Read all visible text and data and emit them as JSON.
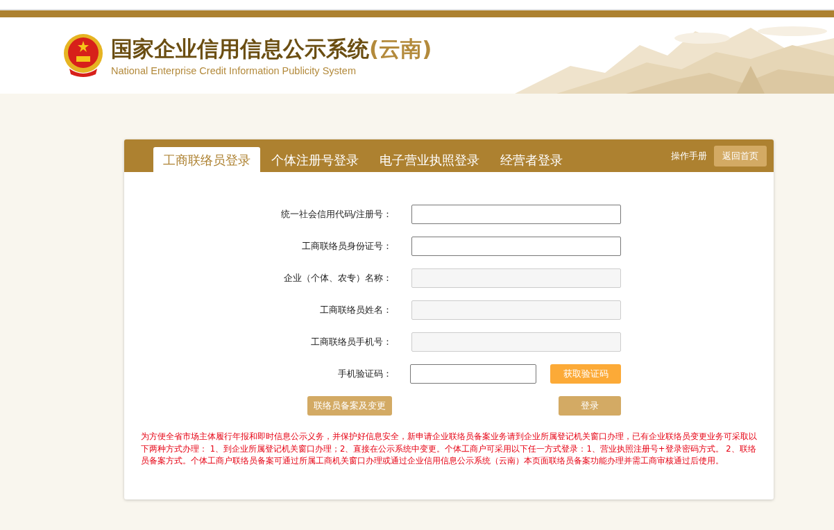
{
  "header": {
    "title": "国家企业信用信息公示系统",
    "region": "(云南)",
    "subtitle": "National Enterprise Credit Information Publicity System"
  },
  "tabs": [
    {
      "label": "工商联络员登录",
      "selected": true
    },
    {
      "label": "个体注册号登录",
      "selected": false
    },
    {
      "label": "电子营业执照登录",
      "selected": false
    },
    {
      "label": "经营者登录",
      "selected": false
    }
  ],
  "manual_link": "操作手册",
  "home_button": "返回首页",
  "fields": [
    {
      "label": "统一社会信用代码/注册号：",
      "disabled": false
    },
    {
      "label": "工商联络员身份证号：",
      "disabled": false
    },
    {
      "label": "企业（个体、农专）名称：",
      "disabled": true
    },
    {
      "label": "工商联络员姓名：",
      "disabled": true
    },
    {
      "label": "工商联络员手机号：",
      "disabled": true
    }
  ],
  "sms": {
    "label": "手机验证码：",
    "button": "获取验证码"
  },
  "register_button": "联络员备案及变更",
  "login_button": "登录",
  "notice": "为方便全省市场主体履行年报和即时信息公示义务，并保护好信息安全，新申请企业联络员备案业务请到企业所属登记机关窗口办理，已有企业联络员变更业务可采取以下两种方式办理： 1、到企业所属登记机关窗口办理；2、直接在公示系统中变更。个体工商户可采用以下任一方式登录：1、营业执照注册号+登录密码方式。 2、联络员备案方式。个体工商户联络员备案可通过所属工商机关窗口办理或通过企业信用信息公示系统（云南）本页面联络员备案功能办理并需工商审核通过后使用。"
}
